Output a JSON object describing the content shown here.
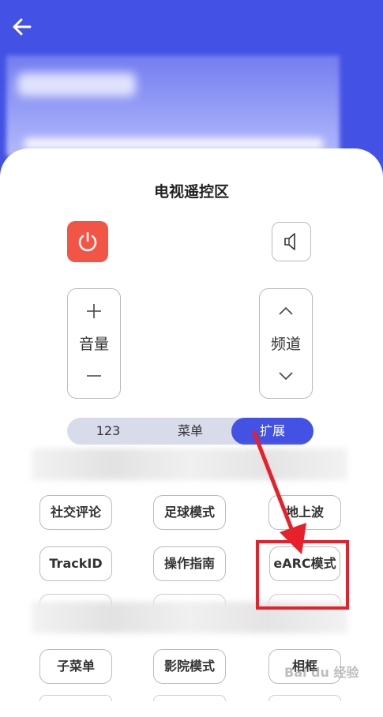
{
  "header": {
    "back_icon": "arrow-left-icon",
    "background_color": "#4352e4"
  },
  "remote": {
    "title": "电视遥控区",
    "power_icon": "power-icon",
    "power_color": "#f25546",
    "mute_icon": "speaker-mute-icon",
    "volume": {
      "up_symbol": "+",
      "label": "音量",
      "down_symbol": "—"
    },
    "channel": {
      "up_icon": "chevron-up-icon",
      "label": "频道",
      "down_icon": "chevron-down-icon"
    }
  },
  "tabs": [
    {
      "label": "123",
      "active": false
    },
    {
      "label": "菜单",
      "active": false
    },
    {
      "label": "扩展",
      "active": true
    }
  ],
  "buttons": {
    "row1": [
      "社交评论",
      "足球模式",
      "地上波"
    ],
    "row2": [
      "TrackID",
      "操作指南",
      "eARC模式"
    ],
    "row3": [
      "子菜单",
      "影院模式",
      "相框"
    ]
  },
  "annotation": {
    "color": "#e8202a",
    "target": "eARC模式"
  },
  "watermark": {
    "text": "Bai du 经验"
  }
}
